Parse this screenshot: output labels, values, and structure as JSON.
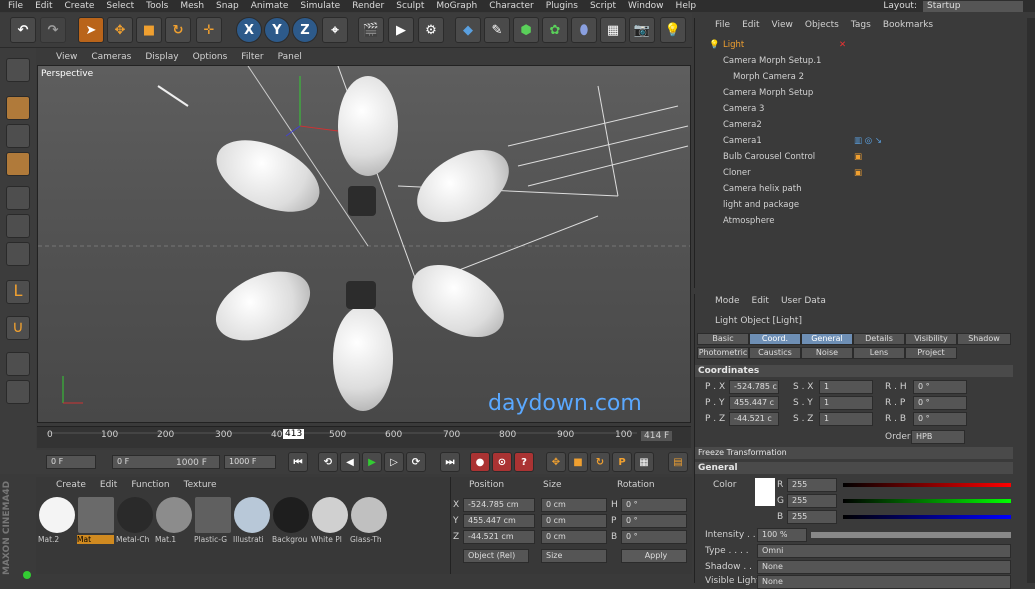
{
  "menubar": {
    "items": [
      "File",
      "Edit",
      "Create",
      "Select",
      "Tools",
      "Mesh",
      "Snap",
      "Animate",
      "Simulate",
      "Render",
      "Sculpt",
      "MoGraph",
      "Character",
      "Plugins",
      "Script",
      "Window",
      "Help"
    ],
    "layout_label": "Layout:",
    "layout_value": "Startup"
  },
  "toolbar": {
    "axis_x": "X",
    "axis_y": "Y",
    "axis_z": "Z"
  },
  "viewport": {
    "menu": [
      "View",
      "Cameras",
      "Display",
      "Options",
      "Filter",
      "Panel"
    ],
    "label": "Perspective",
    "watermark": "daydown.com"
  },
  "timeline": {
    "ticks": [
      "0",
      "100",
      "200",
      "300",
      "400",
      "500",
      "600",
      "700",
      "800",
      "900",
      "100"
    ],
    "playhead": "413",
    "end_frame": "414 F"
  },
  "transport": {
    "current": "0 F",
    "min": "0 F",
    "max": "1000 F",
    "end": "1000 F"
  },
  "materials": {
    "menu": [
      "Create",
      "Edit",
      "Function",
      "Texture"
    ],
    "items": [
      {
        "name": "Mat.2",
        "color": "#f4f4f4"
      },
      {
        "name": "Mat",
        "color": "#6a6a6a"
      },
      {
        "name": "Metal-Ch",
        "color": "#2a2a2a"
      },
      {
        "name": "Mat.1",
        "color": "#8c8c8c"
      },
      {
        "name": "Plastic-G",
        "color": "#606060"
      },
      {
        "name": "Illustrati",
        "color": "#b8c8d8"
      },
      {
        "name": "Backgrou",
        "color": "#1e1e1e"
      },
      {
        "name": "White Pl",
        "color": "#d0d0d0"
      },
      {
        "name": "Glass-Th",
        "color": "#c0c0c0"
      }
    ]
  },
  "coords": {
    "headers": [
      "Position",
      "Size",
      "Rotation"
    ],
    "rows": [
      {
        "axis": "X",
        "pos": "-524.785 cm",
        "size": "0 cm",
        "rlab": "H",
        "rot": "0 °"
      },
      {
        "axis": "Y",
        "pos": "455.447 cm",
        "size": "0 cm",
        "rlab": "P",
        "rot": "0 °"
      },
      {
        "axis": "Z",
        "pos": "-44.521 cm",
        "size": "0 cm",
        "rlab": "B",
        "rot": "0 °"
      }
    ],
    "mode": "Object (Rel)",
    "size_mode": "Size",
    "apply": "Apply"
  },
  "objects": {
    "menu": [
      "File",
      "Edit",
      "View",
      "Objects",
      "Tags",
      "Bookmarks"
    ],
    "items": [
      {
        "name": "Light",
        "active": true
      },
      {
        "name": "Camera Morph Setup.1"
      },
      {
        "name": "Morph Camera 2"
      },
      {
        "name": "Camera Morph Setup"
      },
      {
        "name": "Camera 3"
      },
      {
        "name": "Camera2"
      },
      {
        "name": "Camera1"
      },
      {
        "name": "Bulb Carousel Control"
      },
      {
        "name": "Cloner"
      },
      {
        "name": "Camera helix path"
      },
      {
        "name": "light and package"
      },
      {
        "name": "Atmosphere"
      }
    ]
  },
  "attributes": {
    "menu": [
      "Mode",
      "Edit",
      "User Data"
    ],
    "title": "Light Object [Light]",
    "tabs_row1": [
      "Basic",
      "Coord.",
      "General",
      "Details",
      "Visibility",
      "Shadow"
    ],
    "tabs_row2": [
      "Photometric",
      "Caustics",
      "Noise",
      "Lens",
      "Project"
    ],
    "coordinates_title": "Coordinates",
    "fields": [
      {
        "l": "P . X",
        "v": "-524.785 c"
      },
      {
        "l": "P . Y",
        "v": "455.447 c"
      },
      {
        "l": "P . Z",
        "v": "-44.521 c"
      },
      {
        "l": "S . X",
        "v": "1"
      },
      {
        "l": "S . Y",
        "v": "1"
      },
      {
        "l": "S . Z",
        "v": "1"
      },
      {
        "l": "R . H",
        "v": "0 °"
      },
      {
        "l": "R . P",
        "v": "0 °"
      },
      {
        "l": "R . B",
        "v": "0 °"
      }
    ],
    "order_label": "Order",
    "order_value": "HPB",
    "freeze": "Freeze Transformation",
    "general_title": "General",
    "color_label": "Color",
    "r": "255",
    "g": "255",
    "b": "255",
    "intensity_label": "Intensity . .",
    "intensity": "100 %",
    "type_label": "Type . . . .",
    "type": "Omni",
    "shadow_label": "Shadow . .",
    "shadow": "None",
    "vis_label": "Visible Light",
    "vis": "None"
  },
  "brand": "MAXON CINEMA4D"
}
